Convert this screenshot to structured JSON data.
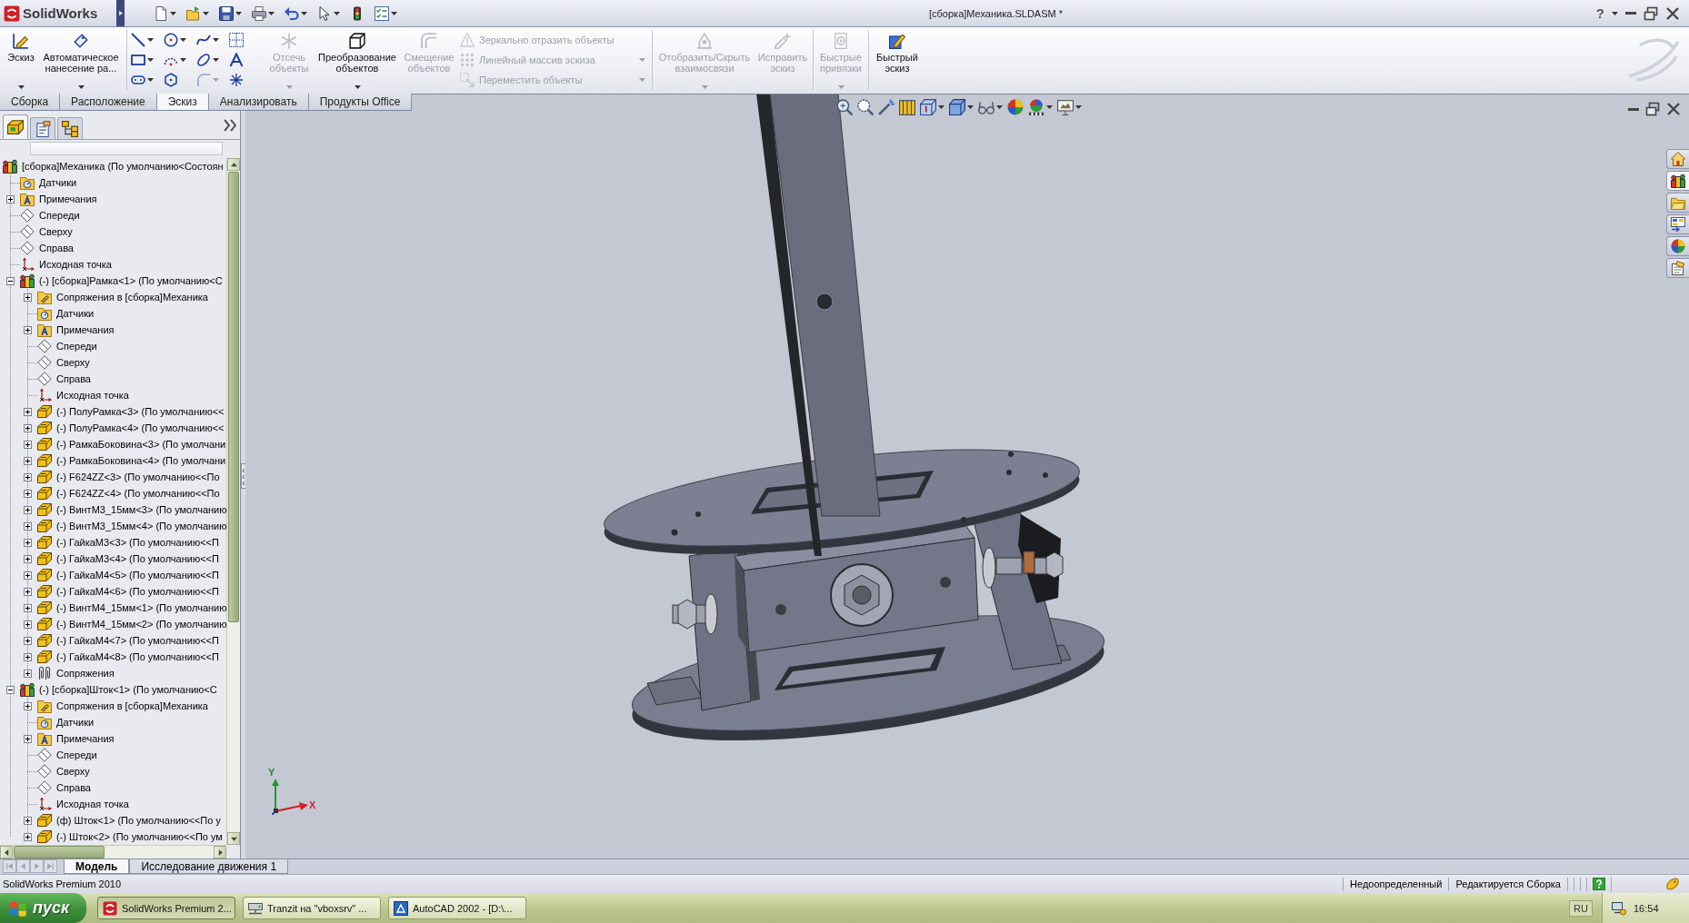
{
  "title_bar": {
    "app_name": "SolidWorks",
    "document_title": "[сборка]Механика.SLDASM *",
    "help": "?"
  },
  "command_manager": {
    "groups": [
      {
        "items": [
          {
            "kind": "large",
            "label": "Эскиз",
            "disabled": false,
            "dropdown": true
          },
          {
            "kind": "large",
            "label": "Автоматическое нанесение ра...",
            "disabled": false,
            "dropdown": true
          }
        ]
      },
      {
        "items": [
          {
            "kind": "tool_grid",
            "tools": [
              {
                "dropdown": true,
                "disabled": false
              },
              {
                "dropdown": true,
                "disabled": false
              },
              {
                "dropdown": true,
                "disabled": false
              },
              {
                "dropdown": false,
                "disabled": false
              },
              {
                "dropdown": true,
                "disabled": false
              },
              {
                "dropdown": true,
                "disabled": false
              },
              {
                "dropdown": true,
                "disabled": false
              },
              {
                "dropdown": false,
                "disabled": false
              },
              {
                "dropdown": true,
                "disabled": false
              },
              {
                "dropdown": false,
                "disabled": false
              },
              {
                "dropdown": true,
                "disabled": true
              },
              {
                "dropdown": false,
                "disabled": false
              }
            ]
          },
          {
            "kind": "large",
            "label": "Отсечь объекты",
            "disabled": true,
            "dropdown": true
          },
          {
            "kind": "large",
            "label": "Преобразование объектов",
            "disabled": false,
            "dropdown": true
          },
          {
            "kind": "large",
            "label": "Смещение объектов",
            "disabled": true,
            "dropdown": false
          },
          {
            "kind": "small_list",
            "entries": [
              {
                "label": "Зеркально отразить объекты",
                "disabled": true,
                "dropdown": false
              },
              {
                "label": "Линейный массив эскиза",
                "disabled": true,
                "dropdown": true
              },
              {
                "label": "Переместить объекты",
                "disabled": true,
                "dropdown": true
              }
            ]
          }
        ]
      },
      {
        "items": [
          {
            "kind": "large",
            "label": "Отобразить/Скрыть взаимосвязи",
            "disabled": true,
            "dropdown": true
          },
          {
            "kind": "large",
            "label": "Исправить эскиз",
            "disabled": true,
            "dropdown": false
          }
        ]
      },
      {
        "items": [
          {
            "kind": "large",
            "label": "Быстрые привязки",
            "disabled": true,
            "dropdown": true
          }
        ]
      },
      {
        "items": [
          {
            "kind": "large",
            "label": "Быстрый эскиз",
            "disabled": false,
            "dropdown": false
          }
        ]
      }
    ]
  },
  "command_tabs": [
    {
      "label": "Сборка",
      "selected": false
    },
    {
      "label": "Расположение",
      "selected": false
    },
    {
      "label": "Эскиз",
      "selected": true
    },
    {
      "label": "Анализировать",
      "selected": false
    },
    {
      "label": "Продукты Office",
      "selected": false
    }
  ],
  "panel_tabs": [
    {
      "selected": true
    },
    {
      "selected": false
    },
    {
      "selected": false
    }
  ],
  "feature_tree": [
    {
      "label": "[сборка]Механика (По умолчанию<Состоян",
      "kind": "assembly",
      "children": [
        {
          "label": "Датчики",
          "kind": "sensors"
        },
        {
          "label": "Примечания",
          "kind": "annotations",
          "expanded": false
        },
        {
          "label": "Спереди",
          "kind": "plane"
        },
        {
          "label": "Сверху",
          "kind": "plane"
        },
        {
          "label": "Справа",
          "kind": "plane"
        },
        {
          "label": "Исходная точка",
          "kind": "origin"
        },
        {
          "label": "(-) [сборка]Рамка<1> (По умолчанию<С",
          "kind": "assembly",
          "expanded": true,
          "children": [
            {
              "label": "Сопряжения в [сборка]Механика",
              "kind": "mates_folder",
              "expanded": false
            },
            {
              "label": "Датчики",
              "kind": "sensors"
            },
            {
              "label": "Примечания",
              "kind": "annotations",
              "expanded": false
            },
            {
              "label": "Спереди",
              "kind": "plane"
            },
            {
              "label": "Сверху",
              "kind": "plane"
            },
            {
              "label": "Справа",
              "kind": "plane"
            },
            {
              "label": "Исходная точка",
              "kind": "origin"
            },
            {
              "label": "(-) ПолуРамка<3> (По умолчанию<<",
              "kind": "part",
              "expanded": false
            },
            {
              "label": "(-) ПолуРамка<4> (По умолчанию<<",
              "kind": "part",
              "expanded": false
            },
            {
              "label": "(-) РамкаБоковина<3> (По умолчани",
              "kind": "part",
              "expanded": false
            },
            {
              "label": "(-) РамкаБоковина<4> (По умолчани",
              "kind": "part",
              "expanded": false
            },
            {
              "label": "(-) F624ZZ<3> (По умолчанию<<По",
              "kind": "part",
              "expanded": false
            },
            {
              "label": "(-) F624ZZ<4> (По умолчанию<<По",
              "kind": "part",
              "expanded": false
            },
            {
              "label": "(-) ВинтМ3_15мм<3> (По умолчанию",
              "kind": "part",
              "expanded": false
            },
            {
              "label": "(-) ВинтМ3_15мм<4> (По умолчанию",
              "kind": "part",
              "expanded": false
            },
            {
              "label": "(-) ГайкаМ3<3> (По умолчанию<<П",
              "kind": "part",
              "expanded": false
            },
            {
              "label": "(-) ГайкаМ3<4> (По умолчанию<<П",
              "kind": "part",
              "expanded": false
            },
            {
              "label": "(-) ГайкаМ4<5> (По умолчанию<<П",
              "kind": "part",
              "expanded": false
            },
            {
              "label": "(-) ГайкаМ4<6> (По умолчанию<<П",
              "kind": "part",
              "expanded": false
            },
            {
              "label": "(-) ВинтМ4_15мм<1> (По умолчанию",
              "kind": "part",
              "expanded": false
            },
            {
              "label": "(-) ВинтМ4_15мм<2> (По умолчанию",
              "kind": "part",
              "expanded": false
            },
            {
              "label": "(-) ГайкаМ4<7> (По умолчанию<<П",
              "kind": "part",
              "expanded": false
            },
            {
              "label": "(-) ГайкаМ4<8> (По умолчанию<<П",
              "kind": "part",
              "expanded": false
            },
            {
              "label": "Сопряжения",
              "kind": "mates",
              "expanded": false
            }
          ]
        },
        {
          "label": "(-) [сборка]Шток<1> (По умолчанию<С",
          "kind": "assembly",
          "expanded": true,
          "children": [
            {
              "label": "Сопряжения в [сборка]Механика",
              "kind": "mates_folder",
              "expanded": false
            },
            {
              "label": "Датчики",
              "kind": "sensors"
            },
            {
              "label": "Примечания",
              "kind": "annotations",
              "expanded": false
            },
            {
              "label": "Спереди",
              "kind": "plane"
            },
            {
              "label": "Сверху",
              "kind": "plane"
            },
            {
              "label": "Справа",
              "kind": "plane"
            },
            {
              "label": "Исходная точка",
              "kind": "origin"
            },
            {
              "label": "(ф) Шток<1> (По умолчанию<<По у",
              "kind": "part",
              "expanded": false
            },
            {
              "label": "(-) Шток<2> (По умолчанию<<По ум",
              "kind": "part",
              "expanded": false
            }
          ]
        }
      ]
    }
  ],
  "graphics_area": {
    "task_pane_tabs": [
      {
        "selected": false
      },
      {
        "selected": true
      },
      {
        "selected": false
      },
      {
        "selected": false
      },
      {
        "selected": false
      },
      {
        "selected": false
      }
    ],
    "triad": {
      "x_label": "X",
      "y_label": "Y"
    }
  },
  "model_tabs": {
    "scroll_disabled": true,
    "tabs": [
      {
        "label": "Модель",
        "selected": true
      },
      {
        "label": "Исследование движения 1",
        "selected": false
      }
    ]
  },
  "status_bar": {
    "product": "SolidWorks Premium 2010",
    "fields": [
      "Недоопределенный",
      "Редактируется Сборка"
    ]
  },
  "taskbar": {
    "start": "пуск",
    "tasks": [
      {
        "label": "SolidWorks Premium 2...",
        "selected": true
      },
      {
        "label": "Tranzit на \"vboxsrv\" ...",
        "selected": false
      },
      {
        "label": "AutoCAD 2002 - [D:\\...",
        "selected": false
      }
    ],
    "language": "RU",
    "clock": "16:54"
  }
}
